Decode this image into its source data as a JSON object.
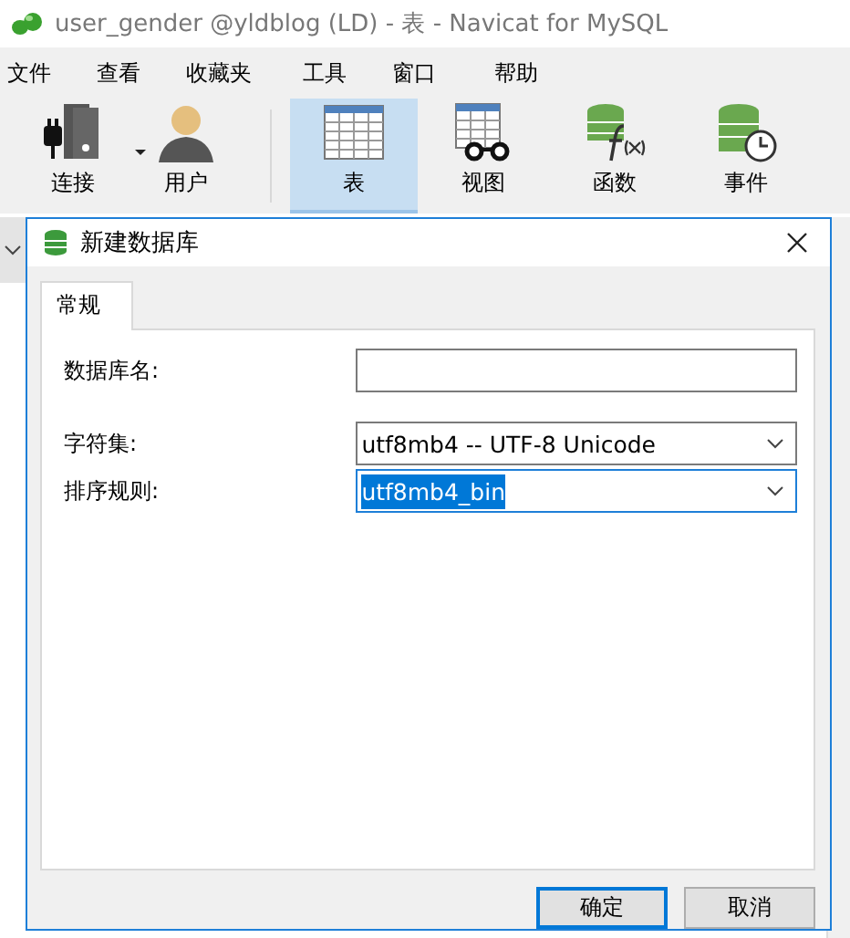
{
  "window": {
    "title": "user_gender @yldblog (LD) - 表 - Navicat for MySQL"
  },
  "menu": [
    "文件",
    "查看",
    "收藏夹",
    "工具",
    "窗口",
    "帮助"
  ],
  "toolbar": [
    {
      "kind": "connect",
      "label": "连接",
      "selected": false,
      "dropdown": true
    },
    {
      "kind": "user",
      "label": "用户",
      "selected": false,
      "dropdown": false
    },
    {
      "kind": "table",
      "label": "表",
      "selected": true,
      "dropdown": false
    },
    {
      "kind": "view",
      "label": "视图",
      "selected": false,
      "dropdown": false
    },
    {
      "kind": "function",
      "label": "函数",
      "selected": false,
      "dropdown": false
    },
    {
      "kind": "event",
      "label": "事件",
      "selected": false,
      "dropdown": false
    }
  ],
  "dialog": {
    "title": "新建数据库",
    "tabs": [
      {
        "label": "常规",
        "selected": true
      }
    ],
    "fields": [
      {
        "kind": "text",
        "label": "数据库名:",
        "focused": false
      },
      {
        "kind": "select",
        "label": "字符集:",
        "value": "utf8mb4 -- UTF-8 Unicode",
        "focused": false
      },
      {
        "kind": "select",
        "label": "排序规则:",
        "value": "utf8mb4_bin",
        "focused": true
      }
    ],
    "buttons": [
      {
        "label": "确定",
        "default": true
      },
      {
        "label": "取消",
        "default": false
      }
    ]
  }
}
